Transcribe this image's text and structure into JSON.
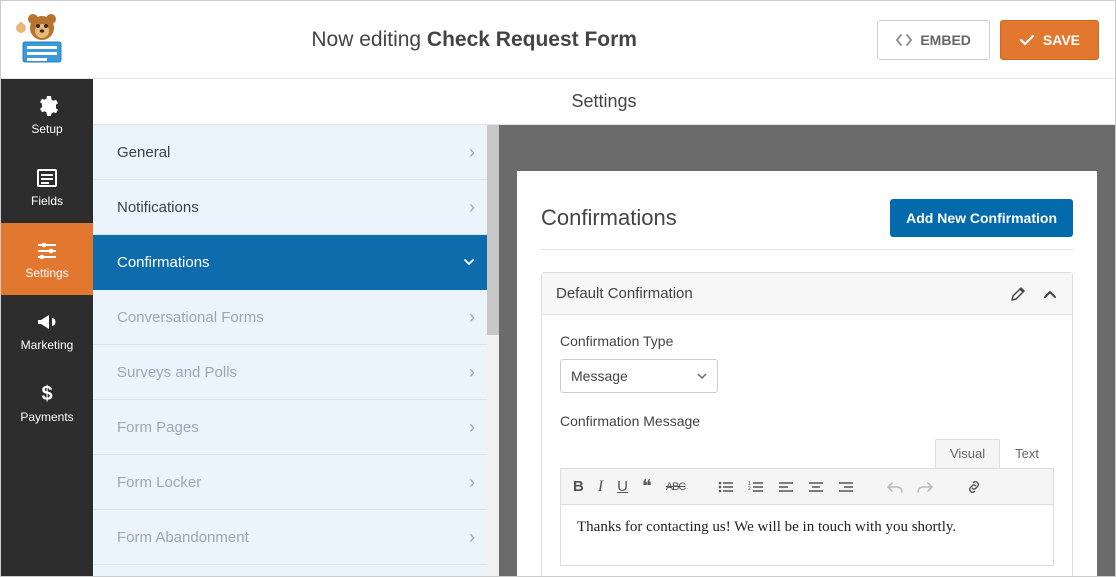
{
  "header": {
    "editing_prefix": "Now editing ",
    "form_name": "Check Request Form",
    "embed_label": "EMBED",
    "save_label": "SAVE"
  },
  "leftnav": {
    "items": [
      {
        "label": "Setup"
      },
      {
        "label": "Fields"
      },
      {
        "label": "Settings"
      },
      {
        "label": "Marketing"
      },
      {
        "label": "Payments"
      }
    ]
  },
  "settings_title": "Settings",
  "mid": {
    "items": [
      {
        "label": "General"
      },
      {
        "label": "Notifications"
      },
      {
        "label": "Confirmations"
      },
      {
        "label": "Conversational Forms"
      },
      {
        "label": "Surveys and Polls"
      },
      {
        "label": "Form Pages"
      },
      {
        "label": "Form Locker"
      },
      {
        "label": "Form Abandonment"
      }
    ]
  },
  "panel": {
    "title": "Confirmations",
    "add_button": "Add New Confirmation",
    "box_title": "Default Confirmation",
    "type_label": "Confirmation Type",
    "type_value": "Message",
    "message_label": "Confirmation Message",
    "tabs": {
      "visual": "Visual",
      "text": "Text"
    },
    "message_body": "Thanks for contacting us! We will be in touch with you shortly."
  }
}
